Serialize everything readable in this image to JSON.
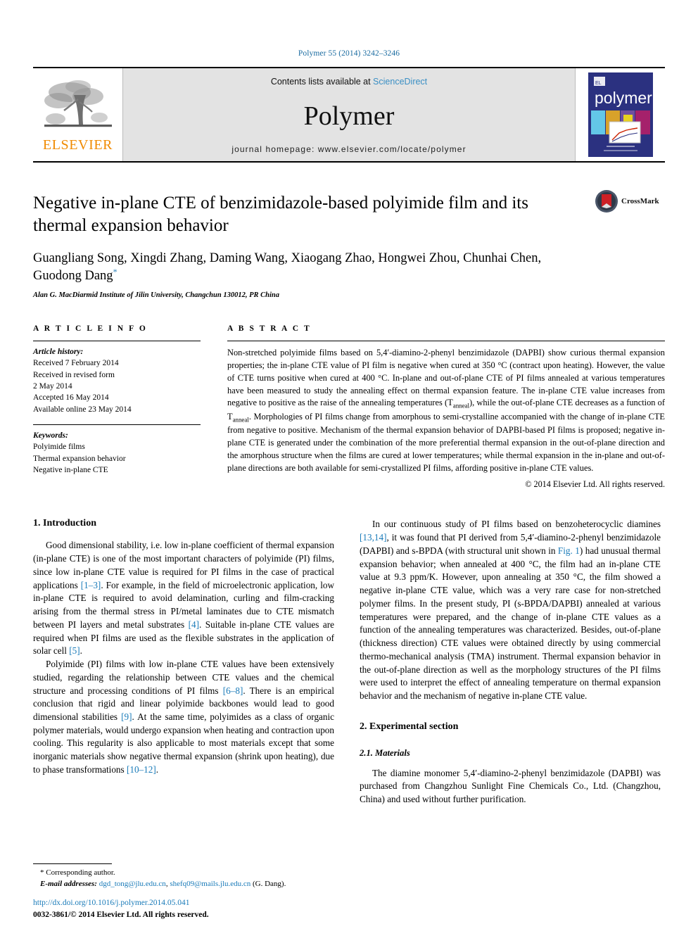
{
  "running_head": "Polymer 55 (2014) 3242–3246",
  "masthead": {
    "publisher_name": "ELSEVIER",
    "contents_prefix": "Contents lists available at ",
    "contents_link": "ScienceDirect",
    "journal_title": "Polymer",
    "homepage": "journal homepage: www.elsevier.com/locate/polymer",
    "cover_title": "polymer"
  },
  "article": {
    "title": "Negative in-plane CTE of benzimidazole-based polyimide film and its thermal expansion behavior",
    "authors": "Guangliang Song, Xingdi Zhang, Daming Wang, Xiaogang Zhao, Hongwei Zhou, Chunhai Chen, Guodong Dang",
    "affiliation": "Alan G. MacDiarmid Institute of Jilin University, Changchun 130012, PR China",
    "crossmark_label": "CrossMark"
  },
  "info": {
    "heading": "A R T I C L E   I N F O",
    "history_label": "Article history:",
    "history": [
      "Received 7 February 2014",
      "Received in revised form",
      "2 May 2014",
      "Accepted 16 May 2014",
      "Available online 23 May 2014"
    ],
    "keywords_label": "Keywords:",
    "keywords": [
      "Polyimide films",
      "Thermal expansion behavior",
      "Negative in-plane CTE"
    ]
  },
  "abstract": {
    "heading": "A B S T R A C T",
    "part1": "Non-stretched polyimide films based on 5,4′-diamino-2-phenyl benzimidazole (DAPBI) show curious thermal expansion properties; the in-plane CTE value of PI film is negative when cured at 350 °C (contract upon heating). However, the value of CTE turns positive when cured at 400 °C. In-plane and out-of-plane CTE of PI films annealed at various temperatures have been measured to study the annealing effect on thermal expansion feature. The in-plane CTE value increases from negative to positive as the raise of the annealing temperatures (T",
    "sub1": "anneal",
    "part2": "), while the out-of-plane CTE decreases as a function of T",
    "sub2": "anneal",
    "part3": ". Morphologies of PI films change from amorphous to semi-crystalline accompanied with the change of in-plane CTE from negative to positive. Mechanism of the thermal expansion behavior of DAPBI-based PI films is proposed; negative in-plane CTE is generated under the combination of the more preferential thermal expansion in the out-of-plane direction and the amorphous structure when the films are cured at lower temperatures; while thermal expansion in the in-plane and out-of-plane directions are both available for semi-crystallized PI films, affording positive in-plane CTE values.",
    "copyright": "© 2014 Elsevier Ltd. All rights reserved."
  },
  "sections": {
    "introduction_heading": "1. Introduction",
    "experimental_heading": "2. Experimental section",
    "materials_heading": "2.1. Materials"
  },
  "body": {
    "p1_a": "Good dimensional stability, i.e. low in-plane coefficient of thermal expansion (in-plane CTE) is one of the most important characters of polyimide (PI) films, since low in-plane CTE value is required for PI films in the case of practical applications ",
    "p1_ref1": "[1–3]",
    "p1_b": ". For example, in the field of microelectronic application, low in-plane CTE is required to avoid delamination, curling and film-cracking arising from the thermal stress in PI/metal laminates due to CTE mismatch between PI layers and metal substrates ",
    "p1_ref2": "[4]",
    "p1_c": ". Suitable in-plane CTE values are required when PI films are used as the flexible substrates in the application of solar cell ",
    "p1_ref3": "[5]",
    "p1_d": ".",
    "p2_a": "Polyimide (PI) films with low in-plane CTE values have been extensively studied, regarding the relationship between CTE values and the chemical structure and processing conditions of PI films ",
    "p2_ref1": "[6–8]",
    "p2_b": ". There is an empirical conclusion that rigid and linear polyimide backbones would lead to good dimensional stabilities ",
    "p2_ref2": "[9]",
    "p2_c": ". At the same time, polyimides as a class of organic polymer materials, would undergo expansion when heating and contraction upon cooling. This regularity is also applicable to most materials except that some inorganic materials show negative thermal expansion (shrink upon heating), due to phase transformations ",
    "p2_ref3": "[10–12]",
    "p2_d": ".",
    "p3_a": "In our continuous study of PI films based on benzoheterocyclic diamines ",
    "p3_ref1": "[13,14]",
    "p3_b": ", it was found that PI derived from 5,4′-diamino-2-phenyl benzimidazole (DAPBI) and s-BPDA (with structural unit shown in ",
    "p3_ref2": "Fig. 1",
    "p3_c": ") had unusual thermal expansion behavior; when annealed at 400 °C, the film had an in-plane CTE value at 9.3 ppm/K. However, upon annealing at 350 °C, the film showed a negative in-plane CTE value, which was a very rare case for non-stretched polymer films. In the present study, PI (s-BPDA/DAPBI) annealed at various temperatures were prepared, and the change of in-plane CTE values as a function of the annealing temperatures was characterized. Besides, out-of-plane (thickness direction) CTE values were obtained directly by using commercial thermo-mechanical analysis (TMA) instrument. Thermal expansion behavior in the out-of-plane direction as well as the morphology structures of the PI films were used to interpret the effect of annealing temperature on thermal expansion behavior and the mechanism of negative in-plane CTE value.",
    "p4": "The diamine monomer 5,4′-diamino-2-phenyl benzimidazole (DAPBI) was purchased from Changzhou Sunlight Fine Chemicals Co., Ltd. (Changzhou, China) and used without further purification."
  },
  "footer": {
    "corresponding": "* Corresponding author.",
    "email_label": "E-mail addresses:",
    "email1": "dgd_tong@jlu.edu.cn",
    "email_sep": ", ",
    "email2": "shefq09@mails.jlu.edu.cn",
    "email_suffix": " (G. Dang).",
    "doi": "http://dx.doi.org/10.1016/j.polymer.2014.05.041",
    "issn": "0032-3861/© 2014 Elsevier Ltd. All rights reserved."
  },
  "colors": {
    "link_blue": "#1a7bb9",
    "elsevier_orange": "#f08a00",
    "masthead_grey": "#e3e3e3",
    "cover_blue": "#2b3180"
  }
}
